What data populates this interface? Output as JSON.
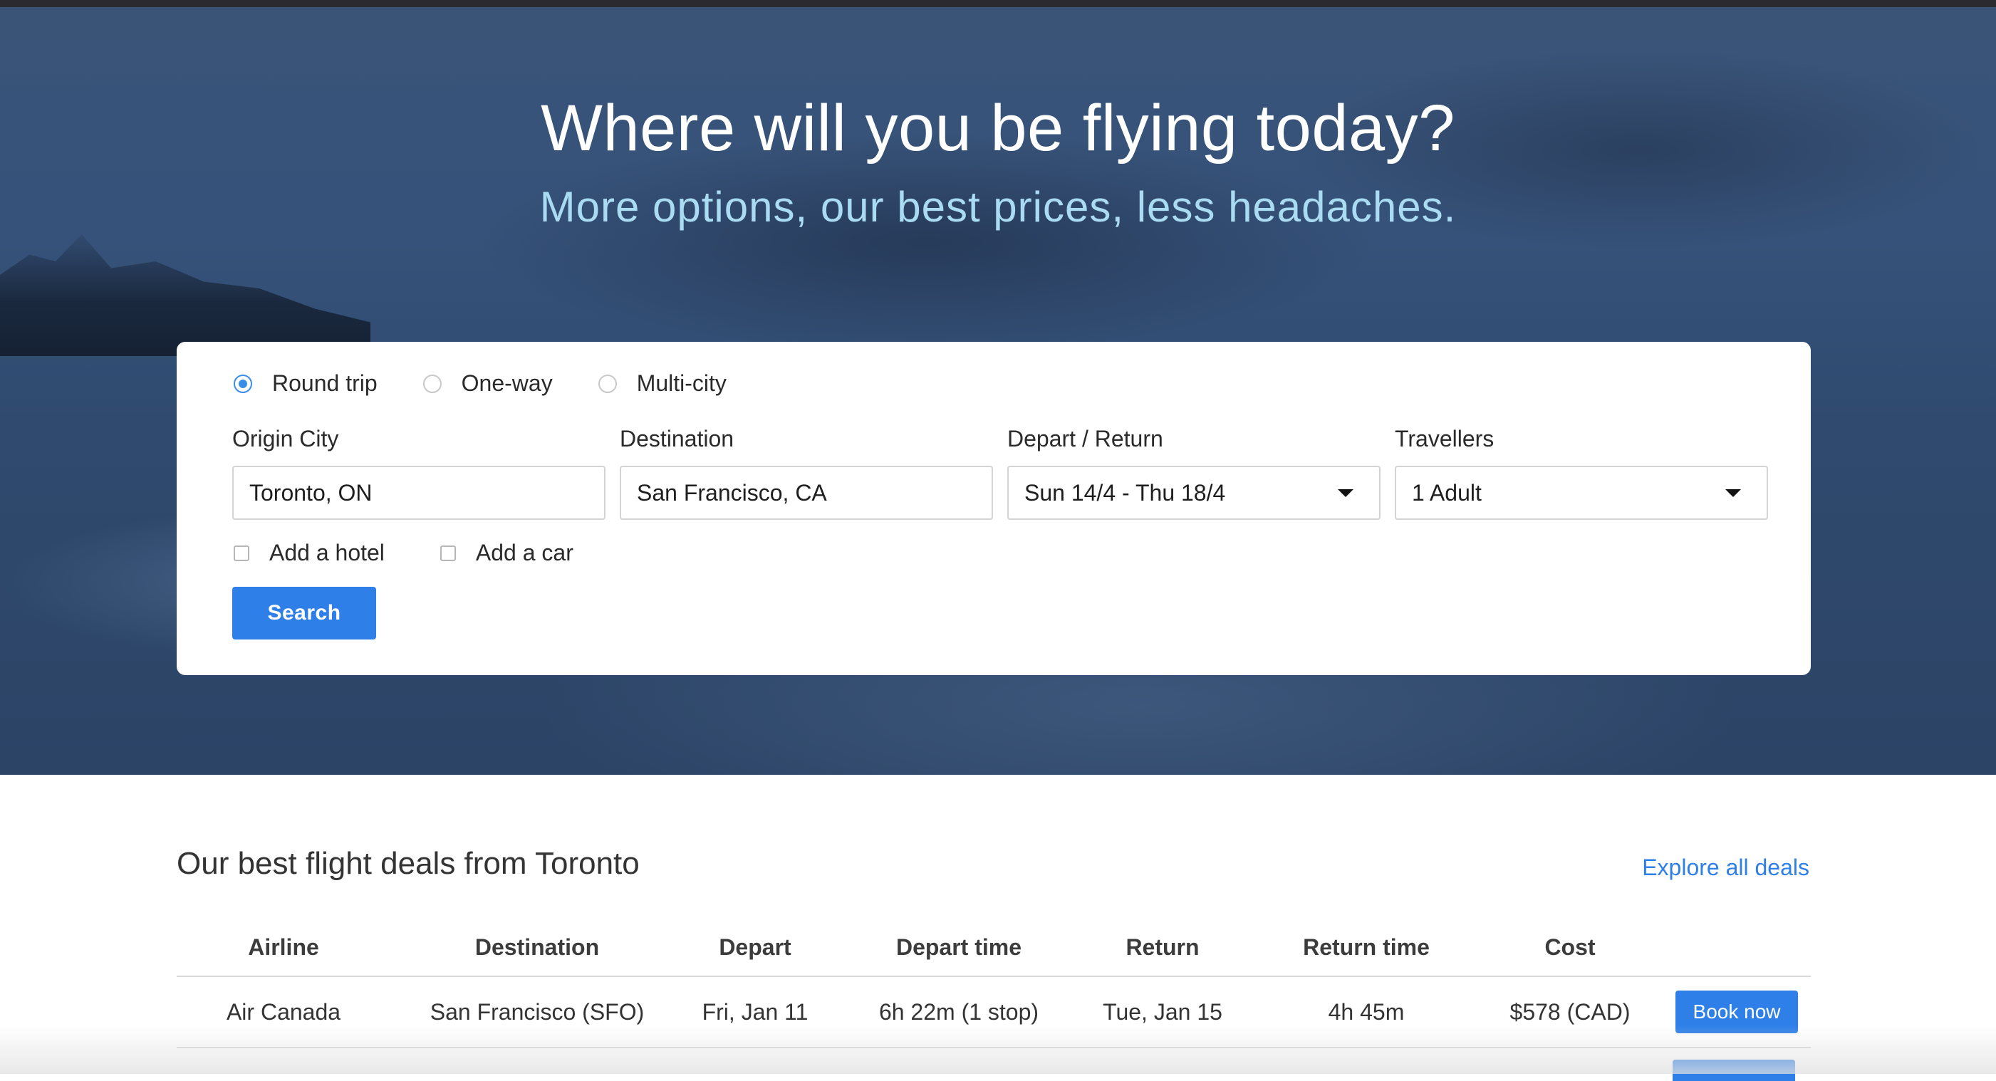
{
  "hero": {
    "title": "Where will you be flying today?",
    "subtitle": "More options, our best prices, less headaches."
  },
  "search_form": {
    "trip_types": [
      {
        "label": "Round trip",
        "selected": true
      },
      {
        "label": "One-way",
        "selected": false
      },
      {
        "label": "Multi-city",
        "selected": false
      }
    ],
    "origin": {
      "label": "Origin City",
      "value": "Toronto, ON"
    },
    "destination": {
      "label": "Destination",
      "value": "San Francisco, CA"
    },
    "dates": {
      "label": "Depart / Return",
      "value": "Sun 14/4 - Thu 18/4"
    },
    "travellers": {
      "label": "Travellers",
      "value": "1 Adult"
    },
    "extras": [
      {
        "label": "Add a hotel",
        "checked": false
      },
      {
        "label": "Add a car",
        "checked": false
      }
    ],
    "search_label": "Search"
  },
  "deals": {
    "heading": "Our best flight deals from Toronto",
    "explore_label": "Explore all deals",
    "columns": [
      "Airline",
      "Destination",
      "Depart",
      "Depart time",
      "Return",
      "Return time",
      "Cost"
    ],
    "rows": [
      {
        "airline": "Air Canada",
        "destination": "San Francisco (SFO)",
        "depart": "Fri, Jan 11",
        "depart_time": "6h 22m (1 stop)",
        "return": "Tue, Jan 15",
        "return_time": "4h 45m",
        "cost": "$578 (CAD)",
        "action": "Book now"
      }
    ]
  },
  "colors": {
    "accent": "#2e7fe8",
    "hero_bg": "#34507a",
    "subtitle": "#a9dcf2"
  }
}
